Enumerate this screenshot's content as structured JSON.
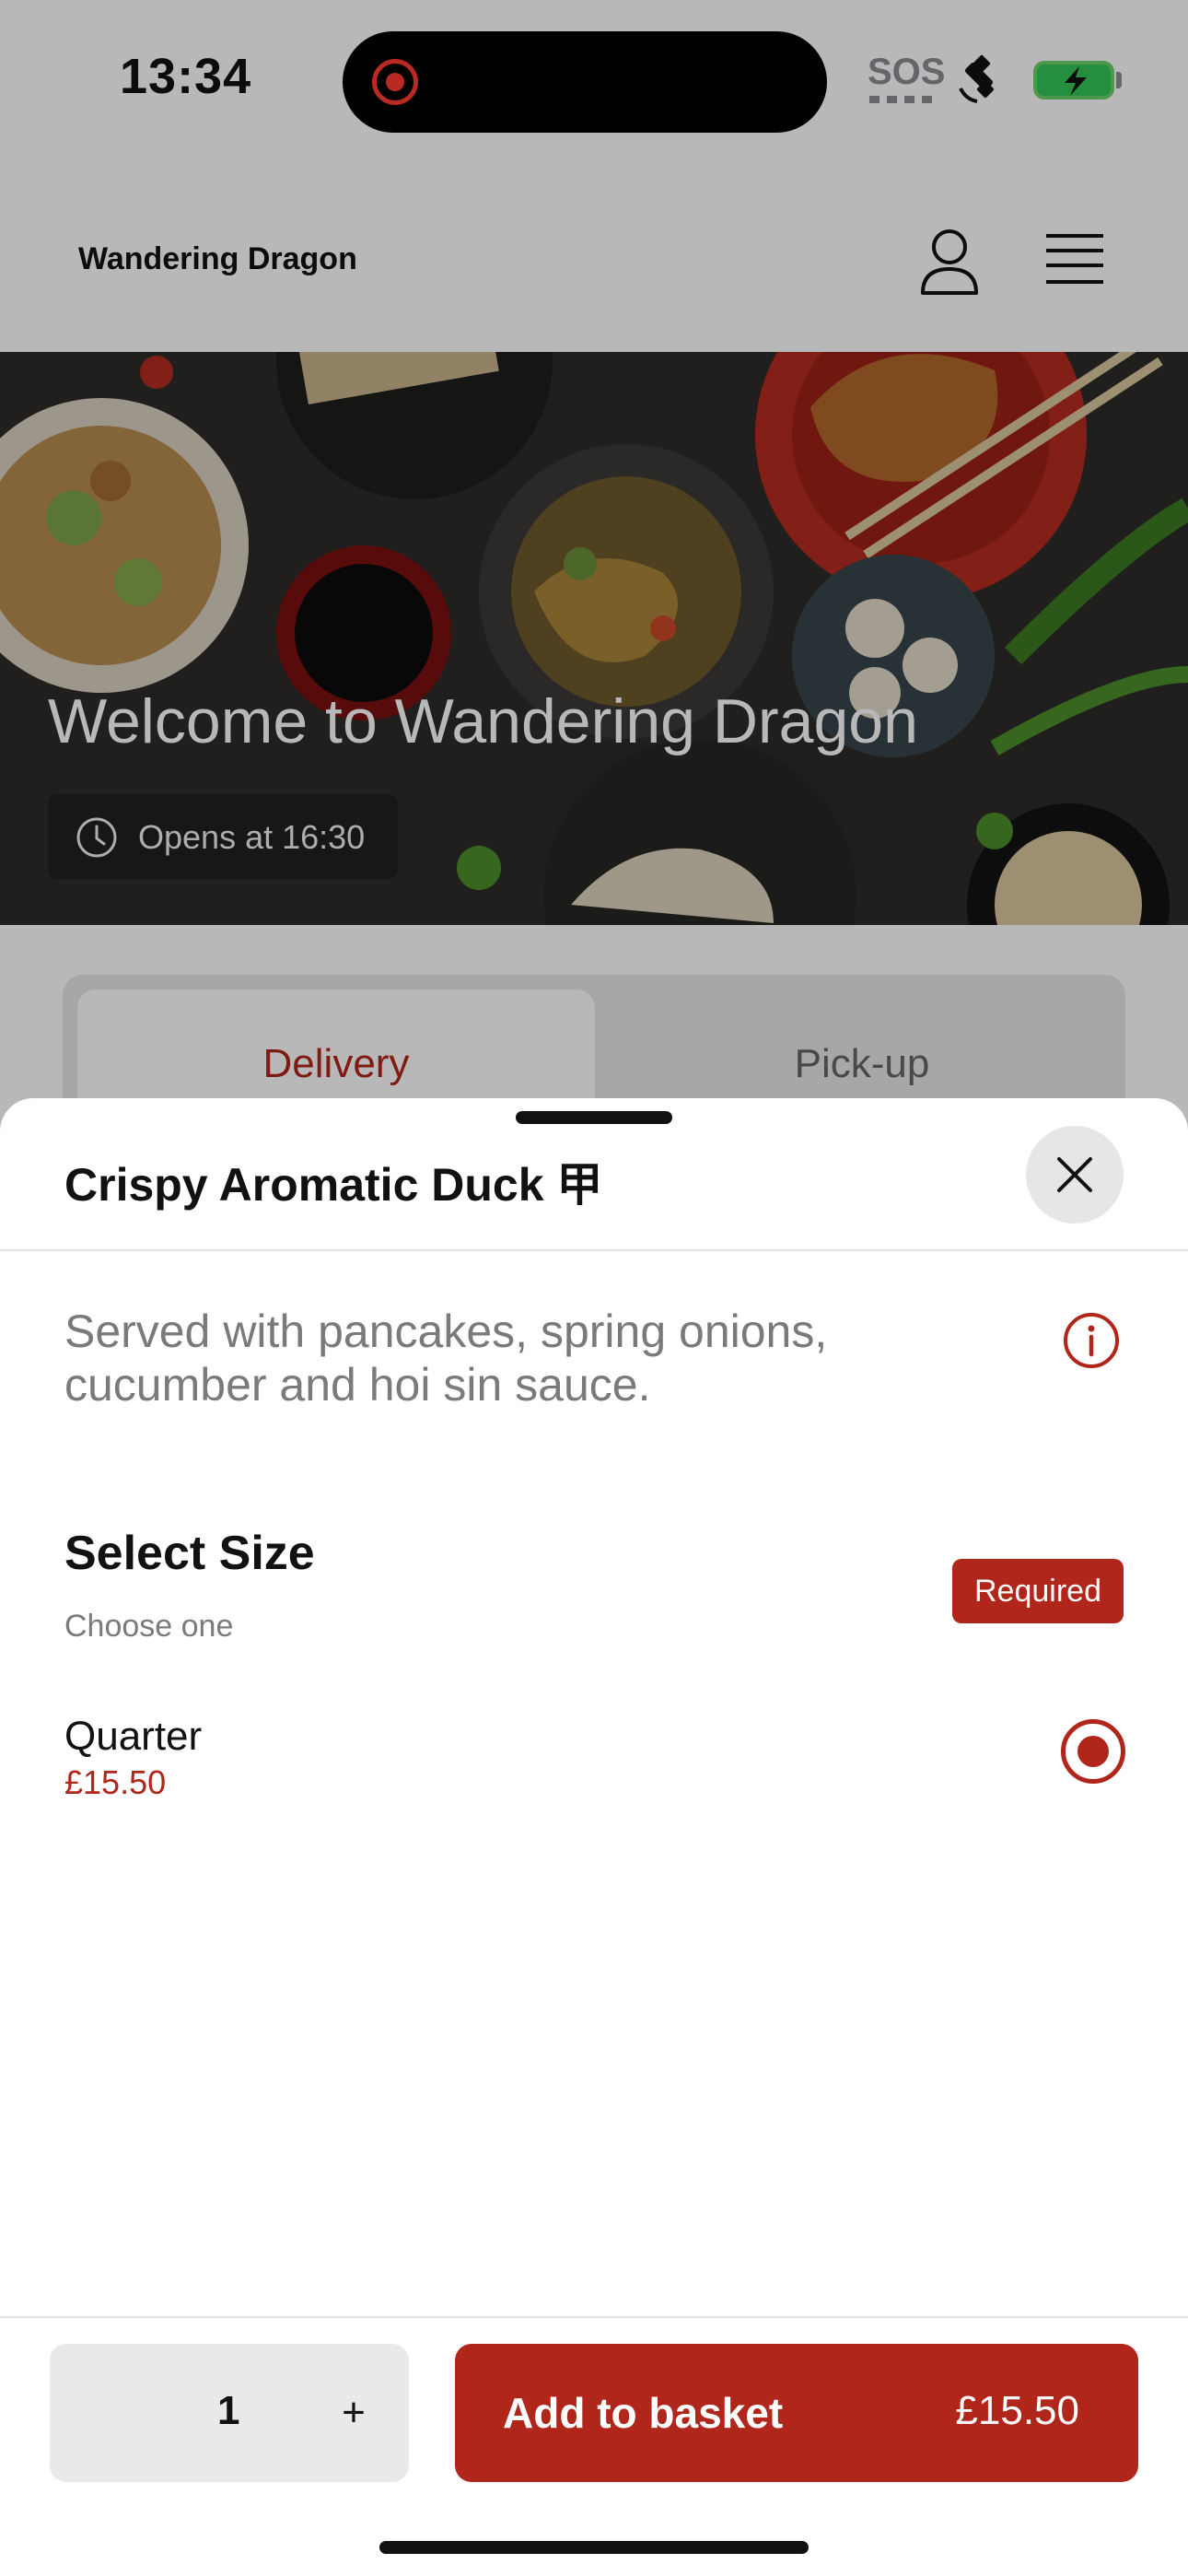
{
  "status_bar": {
    "time": "13:34",
    "sos": "SOS",
    "icons": [
      "screen-recording-icon",
      "satellite-icon",
      "battery-charging-icon"
    ]
  },
  "header": {
    "brand": "Wandering Dragon",
    "icons": [
      "user-icon",
      "menu-icon"
    ]
  },
  "hero": {
    "title": "Welcome to Wandering Dragon",
    "opening": "Opens at 16:30"
  },
  "tabs": [
    {
      "label": "Delivery",
      "active": true
    },
    {
      "label": "Pick-up",
      "active": false
    }
  ],
  "sheet": {
    "title": "Crispy Aromatic Duck 甲",
    "description": "Served with pancakes, spring onions, cucumber and hoi sin sauce.",
    "size_section": {
      "title": "Select Size",
      "subtitle": "Choose one",
      "badge": "Required",
      "options": [
        {
          "name": "Quarter",
          "price": "£15.50",
          "selected": true
        }
      ]
    },
    "footer": {
      "quantity": "1",
      "plus": "+",
      "add_label": "Add to basket",
      "add_price": "£15.50"
    }
  },
  "colors": {
    "accent": "#b0261b",
    "overlay": "rgba(0,0,0,0.28)"
  }
}
